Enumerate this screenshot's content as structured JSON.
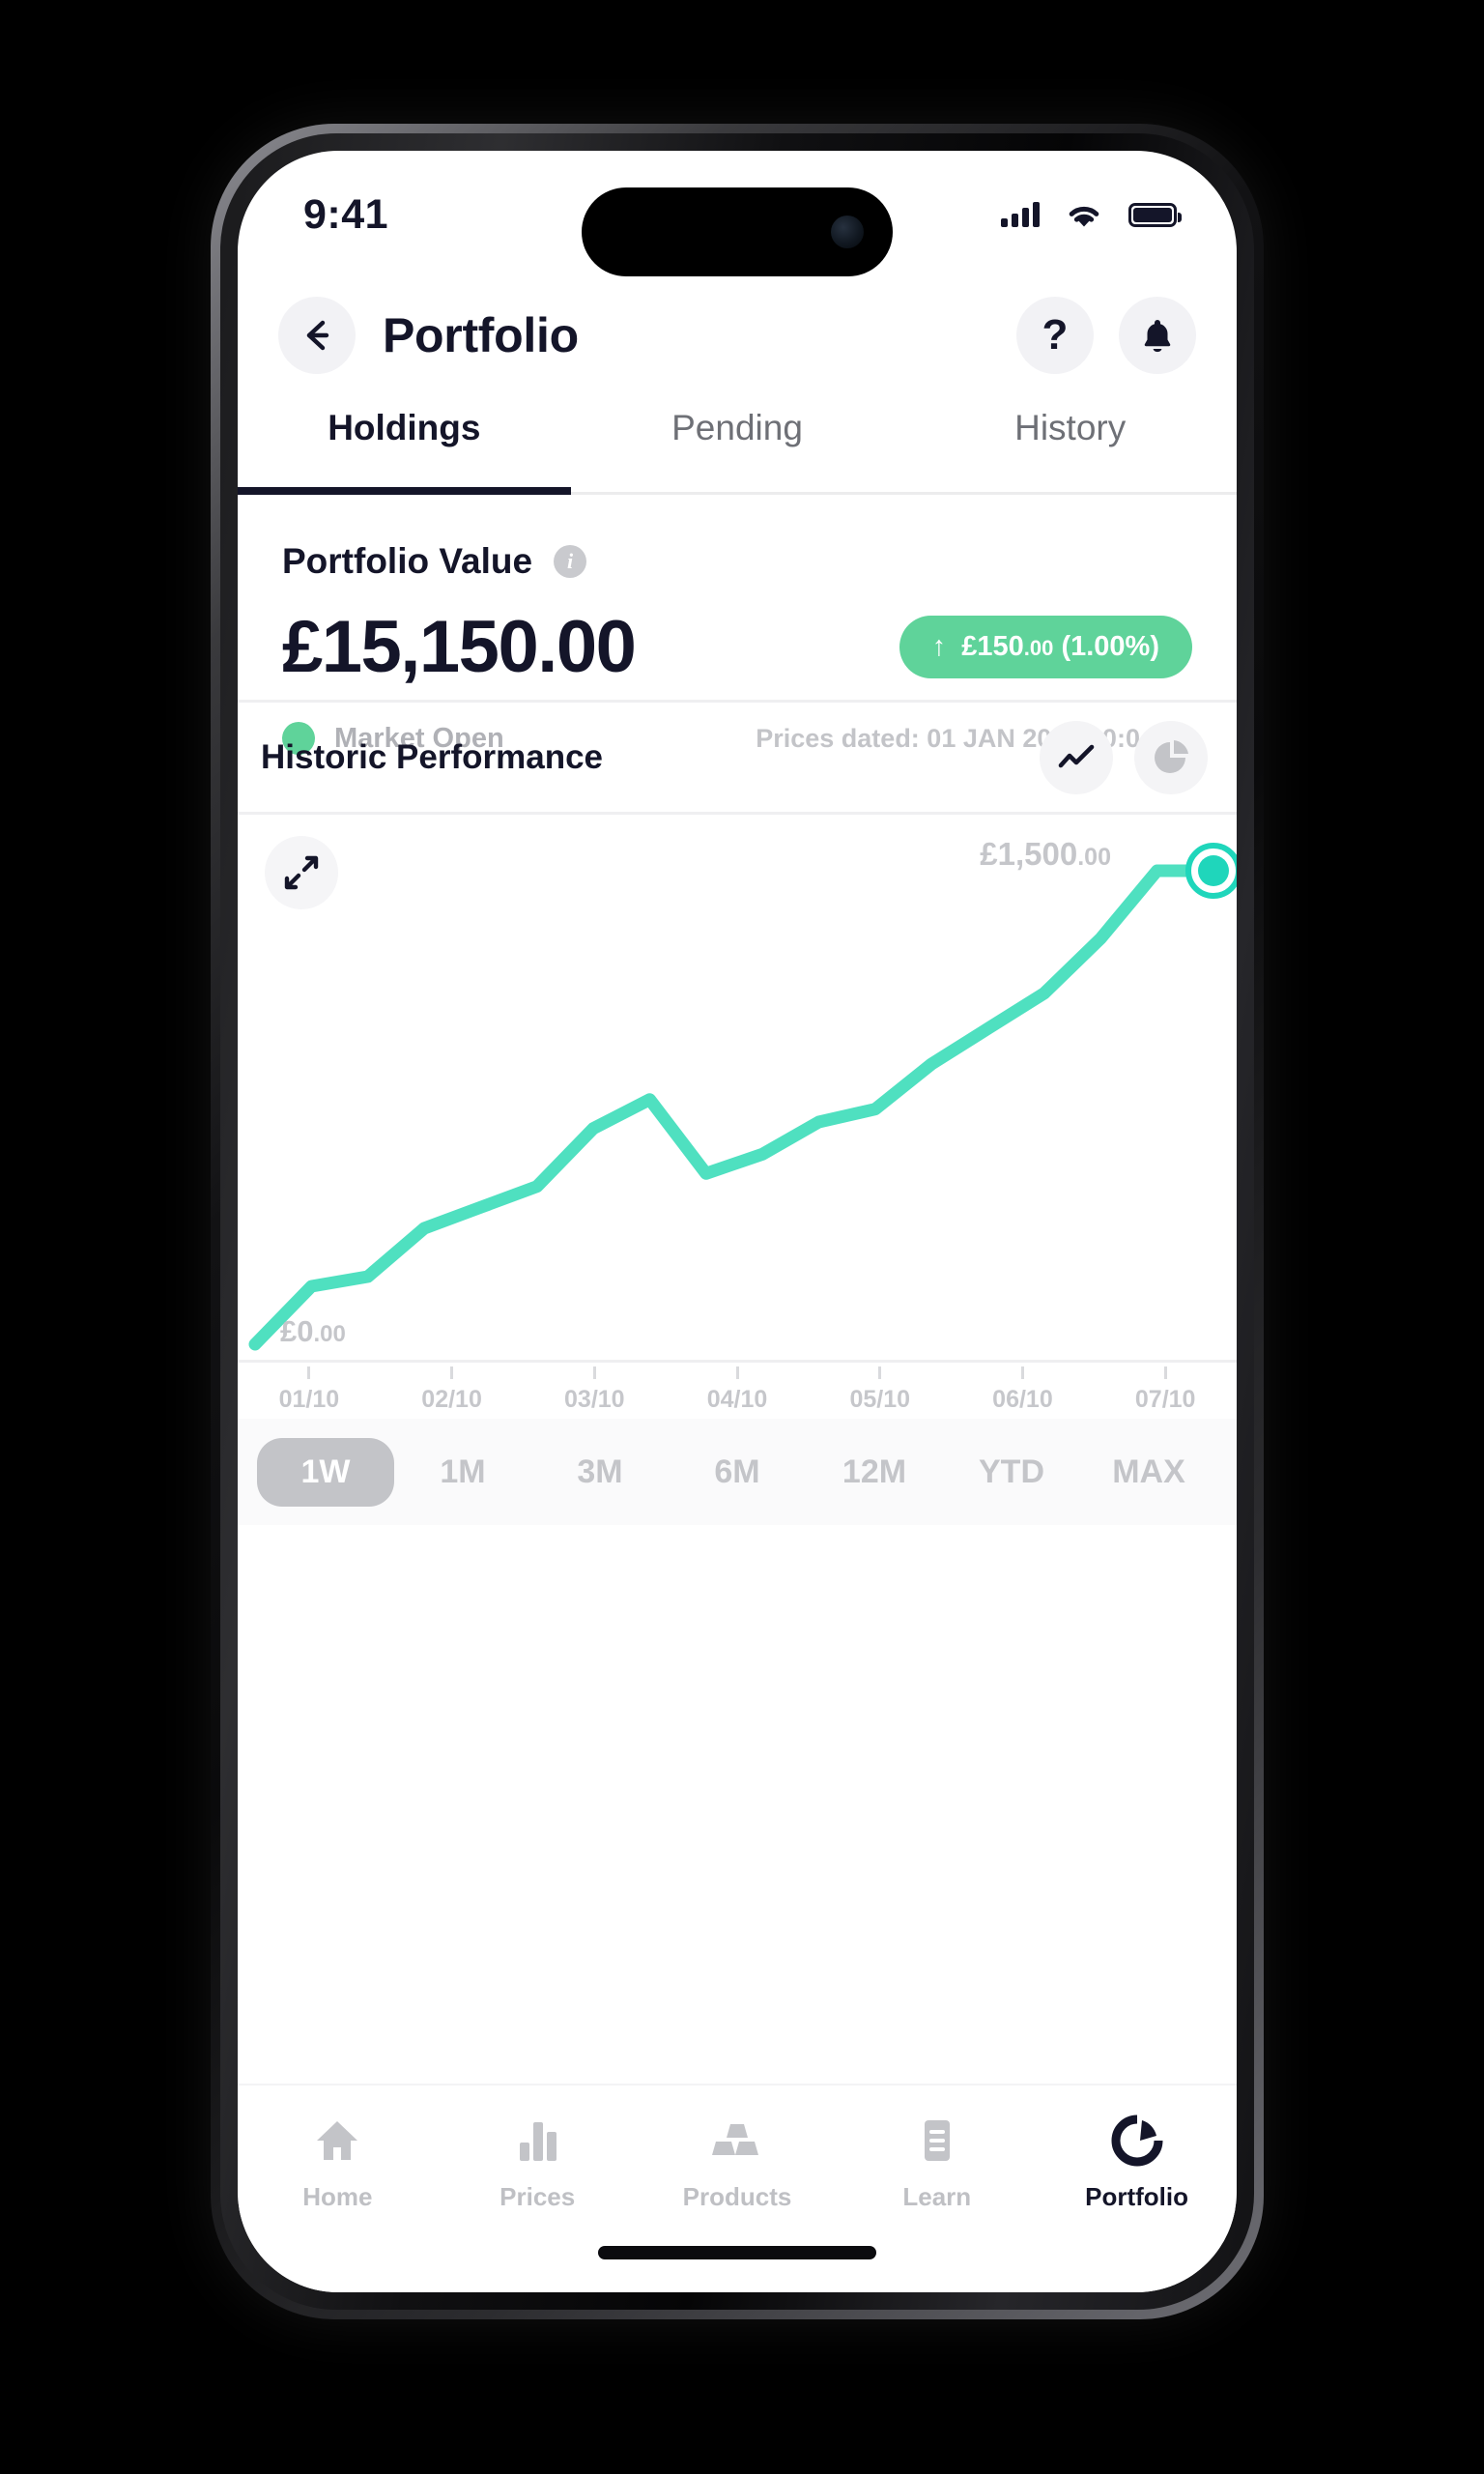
{
  "status_bar": {
    "time": "9:41",
    "icons": [
      "cellular-signal-icon",
      "wifi-icon",
      "battery-icon"
    ]
  },
  "nav": {
    "back_icon": "arrow-left-icon",
    "title": "Portfolio",
    "help_label": "?",
    "help_icon": "question-mark-icon",
    "bell_icon": "bell-icon"
  },
  "tabs": [
    {
      "label": "Holdings",
      "active": true
    },
    {
      "label": "Pending",
      "active": false
    },
    {
      "label": "History",
      "active": false
    }
  ],
  "summary": {
    "label": "Portfolio Value",
    "info_icon": "info-icon",
    "value": "£15,150.00",
    "change_arrow": "↑",
    "change_main": "£150",
    "change_cents": ".00",
    "change_pct": " (1.00%)",
    "market_status": "Market Open",
    "prices_dated": "Prices dated: 01 JAN 2024 10:04:12",
    "accent_green": "#5fd39a",
    "text_dark": "#141529"
  },
  "historic": {
    "title": "Historic Performance",
    "line_chart_icon": "line-chart-icon",
    "pie_chart_icon": "pie-chart-icon",
    "expand_icon": "expand-icon"
  },
  "ranges": [
    {
      "label": "1W",
      "active": true
    },
    {
      "label": "1M",
      "active": false
    },
    {
      "label": "3M",
      "active": false
    },
    {
      "label": "6M",
      "active": false
    },
    {
      "label": "12M",
      "active": false
    },
    {
      "label": "YTD",
      "active": false
    },
    {
      "label": "MAX",
      "active": false
    }
  ],
  "bottom_nav": [
    {
      "label": "Home",
      "icon": "home-icon",
      "active": false
    },
    {
      "label": "Prices",
      "icon": "bar-chart-icon",
      "active": false
    },
    {
      "label": "Products",
      "icon": "gold-bars-icon",
      "active": false
    },
    {
      "label": "Learn",
      "icon": "document-icon",
      "active": false
    },
    {
      "label": "Portfolio",
      "icon": "donut-chart-icon",
      "active": true
    }
  ],
  "chart_data": {
    "type": "line",
    "title": "Historic Performance",
    "xlabel": "",
    "ylabel": "",
    "line_color": "#4fe0c0",
    "marker_color": "#1fd6bb",
    "grid": false,
    "legend": null,
    "max_label": "£1,500",
    "max_label_cents": ".00",
    "min_label": "£0",
    "min_label_cents": ".00",
    "ylim": [
      0,
      1500
    ],
    "xtick_labels": [
      "01/10",
      "02/10",
      "03/10",
      "04/10",
      "05/10",
      "06/10",
      "07/10"
    ],
    "x": [
      0,
      1,
      2,
      3,
      4,
      5,
      6,
      7,
      8,
      9,
      10,
      11,
      12,
      13,
      14,
      15,
      16,
      17
    ],
    "values": [
      30,
      210,
      240,
      390,
      455,
      520,
      700,
      790,
      560,
      620,
      720,
      760,
      900,
      1010,
      1120,
      1290,
      1500,
      1500
    ],
    "end_marker_value": 1500
  }
}
